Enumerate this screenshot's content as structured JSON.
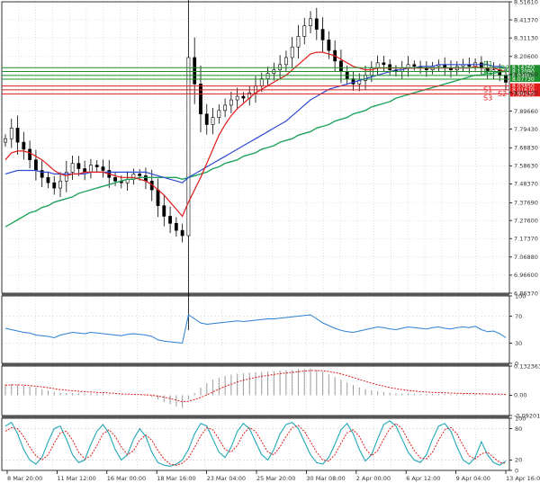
{
  "colors": {
    "grid": "#cfcfcf",
    "frame": "#000000",
    "candle": "#000000",
    "ma_fast": "#e11b1b",
    "ma_mid": "#2f49d1",
    "ma_slow": "#20a35a",
    "support": "#e11b1b",
    "resistance": "#1f8f2e",
    "rsi": "#2a7fd4",
    "macd_hist": "#9a9a9a",
    "macd_signal": "#e11b1b",
    "stoch_main": "#20a8b8",
    "stoch_signal": "#e11b1b"
  },
  "chart_data": [
    {
      "type": "candlestick",
      "panel": "price",
      "ylim": [
        6.8637,
        8.5161
      ],
      "y_ticks": [
        "8.51610",
        "8.41370",
        "8.31130",
        "8.20600",
        "8.10360",
        "8.00120",
        "7.89660",
        "7.79430",
        "7.68830",
        "7.58630",
        "7.48370",
        "7.37690",
        "7.27600",
        "7.17370",
        "7.06880",
        "6.96600",
        "6.86370"
      ],
      "x_ticks": [
        "8 Mar 20:00",
        "11 Mar 12:00",
        "16 Mar 00:00",
        "18 Mar 16:00",
        "23 Mar 04:00",
        "25 Mar 20:00",
        "30 Mar 08:00",
        "2 Apr 00:00",
        "6 Apr 12:00",
        "9 Apr 04:00",
        "13 Apr 16:00"
      ],
      "close": [
        7.74,
        7.8,
        7.72,
        7.68,
        7.62,
        7.56,
        7.52,
        7.49,
        7.46,
        7.5,
        7.55,
        7.6,
        7.57,
        7.55,
        7.59,
        7.58,
        7.56,
        7.52,
        7.5,
        7.49,
        7.51,
        7.54,
        7.53,
        7.5,
        7.45,
        7.36,
        7.3,
        7.26,
        7.22,
        7.19,
        8.2,
        8.05,
        7.88,
        7.82,
        7.86,
        7.9,
        7.93,
        7.96,
        7.98,
        7.97,
        8.0,
        8.04,
        8.08,
        8.11,
        8.13,
        8.16,
        8.2,
        8.26,
        8.32,
        8.38,
        8.42,
        8.36,
        8.3,
        8.24,
        8.18,
        8.12,
        8.08,
        8.05,
        8.07,
        8.1,
        8.14,
        8.17,
        8.16,
        8.13,
        8.12,
        8.14,
        8.16,
        8.15,
        8.14,
        8.13,
        8.15,
        8.16,
        8.14,
        8.13,
        8.15,
        8.16,
        8.15,
        8.17,
        8.14,
        8.12,
        8.13,
        8.1,
        8.06
      ],
      "ma_fast": [
        7.62,
        7.66,
        7.67,
        7.67,
        7.66,
        7.64,
        7.62,
        7.59,
        7.56,
        7.54,
        7.53,
        7.54,
        7.54,
        7.55,
        7.55,
        7.55,
        7.55,
        7.54,
        7.53,
        7.52,
        7.52,
        7.52,
        7.51,
        7.5,
        7.48,
        7.45,
        7.42,
        7.38,
        7.34,
        7.3,
        7.38,
        7.45,
        7.52,
        7.6,
        7.68,
        7.76,
        7.82,
        7.87,
        7.91,
        7.94,
        7.97,
        8.0,
        8.02,
        8.04,
        8.06,
        8.08,
        8.1,
        8.13,
        8.16,
        8.19,
        8.22,
        8.23,
        8.23,
        8.22,
        8.21,
        8.19,
        8.17,
        8.15,
        8.14,
        8.13,
        8.13,
        8.14,
        8.14,
        8.14,
        8.14,
        8.14,
        8.14,
        8.14,
        8.14,
        8.14,
        8.14,
        8.14,
        8.14,
        8.14,
        8.14,
        8.14,
        8.14,
        8.15,
        8.14,
        8.14,
        8.14,
        8.13,
        8.12
      ],
      "ma_mid": [
        7.54,
        7.55,
        7.56,
        7.56,
        7.56,
        7.56,
        7.55,
        7.55,
        7.54,
        7.54,
        7.54,
        7.54,
        7.54,
        7.54,
        7.55,
        7.55,
        7.55,
        7.55,
        7.55,
        7.55,
        7.55,
        7.55,
        7.55,
        7.55,
        7.54,
        7.53,
        7.52,
        7.51,
        7.5,
        7.49,
        7.52,
        7.54,
        7.56,
        7.58,
        7.6,
        7.62,
        7.64,
        7.66,
        7.68,
        7.7,
        7.72,
        7.74,
        7.76,
        7.78,
        7.8,
        7.82,
        7.84,
        7.87,
        7.9,
        7.93,
        7.96,
        7.98,
        8.0,
        8.02,
        8.03,
        8.04,
        8.05,
        8.06,
        8.07,
        8.08,
        8.09,
        8.1,
        8.11,
        8.12,
        8.13,
        8.13,
        8.14,
        8.14,
        8.15,
        8.15,
        8.15,
        8.16,
        8.16,
        8.16,
        8.16,
        8.16,
        8.16,
        8.16,
        8.16,
        8.16,
        8.15,
        8.15,
        8.14
      ],
      "ma_slow": [
        7.24,
        7.26,
        7.28,
        7.3,
        7.32,
        7.33,
        7.35,
        7.36,
        7.38,
        7.39,
        7.4,
        7.41,
        7.43,
        7.44,
        7.45,
        7.46,
        7.47,
        7.48,
        7.49,
        7.5,
        7.51,
        7.51,
        7.52,
        7.52,
        7.52,
        7.52,
        7.52,
        7.52,
        7.52,
        7.51,
        7.52,
        7.53,
        7.54,
        7.55,
        7.57,
        7.58,
        7.6,
        7.61,
        7.62,
        7.64,
        7.65,
        7.66,
        7.68,
        7.69,
        7.7,
        7.72,
        7.73,
        7.74,
        7.76,
        7.77,
        7.78,
        7.8,
        7.81,
        7.82,
        7.84,
        7.85,
        7.86,
        7.88,
        7.89,
        7.9,
        7.92,
        7.93,
        7.94,
        7.95,
        7.97,
        7.98,
        7.99,
        8.0,
        8.01,
        8.02,
        8.03,
        8.04,
        8.05,
        8.06,
        8.07,
        8.08,
        8.09,
        8.1,
        8.1,
        8.11,
        8.11,
        8.12,
        8.12
      ],
      "levels": [
        {
          "label": "R1",
          "kind": "resistance",
          "value": 8.1426
        },
        {
          "label": "R2",
          "kind": "resistance",
          "value": 8.1209
        },
        {
          "label": "R1",
          "kind": "resistance",
          "value": 8.0986
        },
        {
          "label": "",
          "kind": "resistance",
          "value": 8.0773
        },
        {
          "label": "S1",
          "kind": "support",
          "value": 8.0385
        },
        {
          "label": "S2",
          "kind": "support",
          "value": 8.0167
        },
        {
          "label": "S3",
          "kind": "support",
          "value": 7.9943
        }
      ],
      "price_tags": [
        "8.14260",
        "8.12090",
        "8.09860",
        "8.07730",
        "8.03850",
        "8.01670",
        "7.99430"
      ]
    },
    {
      "type": "line",
      "panel": "rsi",
      "ylim": [
        0,
        100
      ],
      "y_ticks": [
        "100",
        "70",
        "30",
        "0"
      ],
      "values": [
        52,
        50,
        48,
        46,
        45,
        42,
        41,
        40,
        38,
        42,
        44,
        46,
        45,
        44,
        46,
        45,
        44,
        43,
        42,
        41,
        43,
        44,
        43,
        42,
        40,
        35,
        33,
        32,
        31,
        30,
        72,
        66,
        60,
        58,
        59,
        60,
        61,
        62,
        63,
        62,
        63,
        64,
        65,
        66,
        66,
        67,
        68,
        69,
        70,
        71,
        72,
        66,
        60,
        56,
        52,
        49,
        47,
        46,
        48,
        50,
        52,
        54,
        53,
        51,
        50,
        52,
        54,
        53,
        52,
        51,
        53,
        54,
        52,
        51,
        53,
        54,
        53,
        55,
        50,
        47,
        48,
        44,
        38
      ]
    },
    {
      "type": "bar",
      "panel": "macd",
      "ylim": [
        -0.092012,
        0.132363
      ],
      "y_ticks": [
        "0.132363",
        "0.00",
        "-0.092012"
      ],
      "values": [
        0.05,
        0.052,
        0.048,
        0.044,
        0.04,
        0.034,
        0.028,
        0.022,
        0.016,
        0.012,
        0.01,
        0.01,
        0.009,
        0.008,
        0.009,
        0.008,
        0.006,
        0.003,
        0.0,
        -0.002,
        -0.001,
        0.0,
        -0.001,
        -0.003,
        -0.008,
        -0.018,
        -0.03,
        -0.04,
        -0.05,
        -0.058,
        -0.02,
        0.01,
        0.035,
        0.055,
        0.07,
        0.08,
        0.088,
        0.094,
        0.098,
        0.1,
        0.102,
        0.104,
        0.106,
        0.108,
        0.11,
        0.112,
        0.114,
        0.116,
        0.118,
        0.12,
        0.122,
        0.115,
        0.106,
        0.095,
        0.083,
        0.07,
        0.058,
        0.046,
        0.036,
        0.028,
        0.022,
        0.018,
        0.014,
        0.011,
        0.009,
        0.008,
        0.008,
        0.007,
        0.006,
        0.006,
        0.006,
        0.006,
        0.005,
        0.005,
        0.005,
        0.005,
        0.005,
        0.005,
        0.004,
        0.003,
        0.003,
        0.002,
        0.001
      ],
      "signal": [
        0.045,
        0.047,
        0.047,
        0.046,
        0.044,
        0.041,
        0.038,
        0.034,
        0.03,
        0.026,
        0.023,
        0.02,
        0.018,
        0.016,
        0.015,
        0.013,
        0.012,
        0.01,
        0.008,
        0.006,
        0.005,
        0.004,
        0.003,
        0.002,
        0.0,
        -0.004,
        -0.009,
        -0.015,
        -0.022,
        -0.029,
        -0.027,
        -0.02,
        -0.01,
        0.002,
        0.015,
        0.028,
        0.04,
        0.05,
        0.06,
        0.068,
        0.075,
        0.081,
        0.086,
        0.09,
        0.094,
        0.098,
        0.101,
        0.104,
        0.107,
        0.11,
        0.112,
        0.112,
        0.111,
        0.108,
        0.103,
        0.097,
        0.089,
        0.081,
        0.072,
        0.063,
        0.055,
        0.048,
        0.041,
        0.035,
        0.03,
        0.026,
        0.022,
        0.019,
        0.017,
        0.015,
        0.013,
        0.012,
        0.011,
        0.01,
        0.009,
        0.008,
        0.008,
        0.007,
        0.007,
        0.006,
        0.005,
        0.005,
        0.004
      ]
    },
    {
      "type": "line",
      "panel": "stochastic",
      "ylim": [
        0,
        100
      ],
      "y_ticks": [
        "100",
        "80",
        "20",
        "0"
      ],
      "values": [
        85,
        92,
        70,
        40,
        20,
        12,
        25,
        55,
        80,
        85,
        60,
        30,
        15,
        20,
        50,
        75,
        88,
        70,
        40,
        20,
        30,
        60,
        80,
        65,
        35,
        15,
        10,
        8,
        12,
        20,
        40,
        70,
        90,
        85,
        60,
        35,
        25,
        45,
        75,
        90,
        80,
        55,
        30,
        20,
        40,
        70,
        88,
        92,
        80,
        55,
        30,
        15,
        12,
        25,
        50,
        78,
        90,
        70,
        40,
        18,
        30,
        60,
        88,
        95,
        85,
        60,
        35,
        20,
        15,
        30,
        60,
        85,
        90,
        75,
        45,
        20,
        12,
        25,
        55,
        30,
        15,
        10,
        18
      ],
      "signal": [
        75,
        82,
        80,
        65,
        45,
        28,
        20,
        30,
        52,
        72,
        75,
        58,
        35,
        22,
        28,
        48,
        70,
        78,
        65,
        45,
        30,
        38,
        58,
        68,
        58,
        38,
        22,
        12,
        10,
        14,
        24,
        44,
        66,
        82,
        78,
        60,
        40,
        35,
        48,
        70,
        82,
        75,
        55,
        35,
        30,
        45,
        65,
        82,
        86,
        75,
        55,
        35,
        20,
        18,
        30,
        52,
        72,
        78,
        65,
        42,
        28,
        38,
        60,
        80,
        90,
        80,
        58,
        38,
        24,
        22,
        35,
        58,
        78,
        82,
        70,
        48,
        28,
        22,
        32,
        35,
        25,
        15,
        14
      ]
    }
  ]
}
